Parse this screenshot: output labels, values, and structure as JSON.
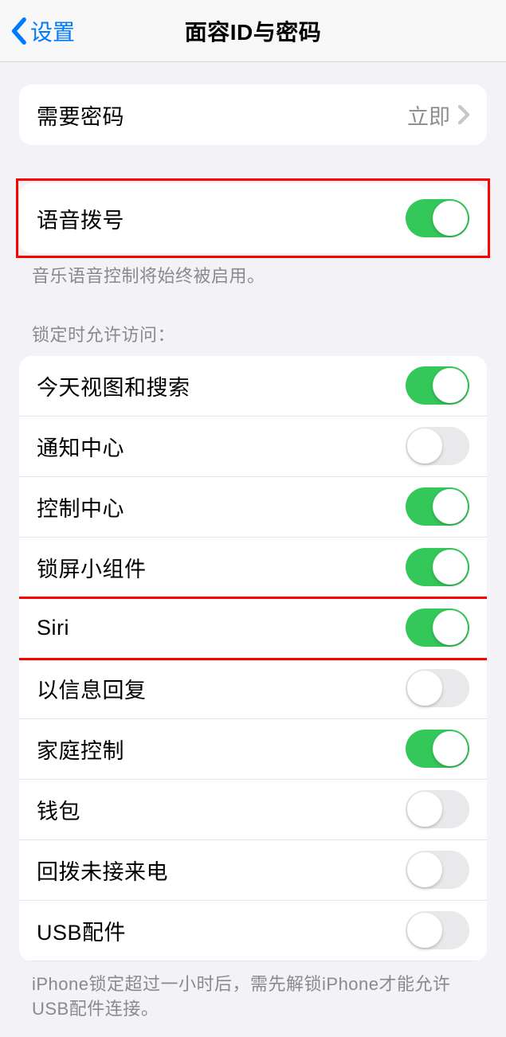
{
  "nav": {
    "back_label": "设置",
    "title": "面容ID与密码"
  },
  "group_passcode": {
    "label": "需要密码",
    "value": "立即"
  },
  "group_voice": {
    "label": "语音拨号",
    "on": true,
    "footer": "音乐语音控制将始终被启用。"
  },
  "group_lock": {
    "header": "锁定时允许访问：",
    "items": [
      {
        "label": "今天视图和搜索",
        "on": true
      },
      {
        "label": "通知中心",
        "on": false
      },
      {
        "label": "控制中心",
        "on": true
      },
      {
        "label": "锁屏小组件",
        "on": true
      },
      {
        "label": "Siri",
        "on": true
      },
      {
        "label": "以信息回复",
        "on": false
      },
      {
        "label": "家庭控制",
        "on": true
      },
      {
        "label": "钱包",
        "on": false
      },
      {
        "label": "回拨未接来电",
        "on": false
      },
      {
        "label": "USB配件",
        "on": false
      }
    ],
    "footer": "iPhone锁定超过一小时后，需先解锁iPhone才能允许USB配件连接。"
  },
  "highlight_indices": [
    0,
    5
  ],
  "colors": {
    "accent": "#007aff",
    "toggle_on": "#34c759",
    "highlight": "#ff0000"
  }
}
